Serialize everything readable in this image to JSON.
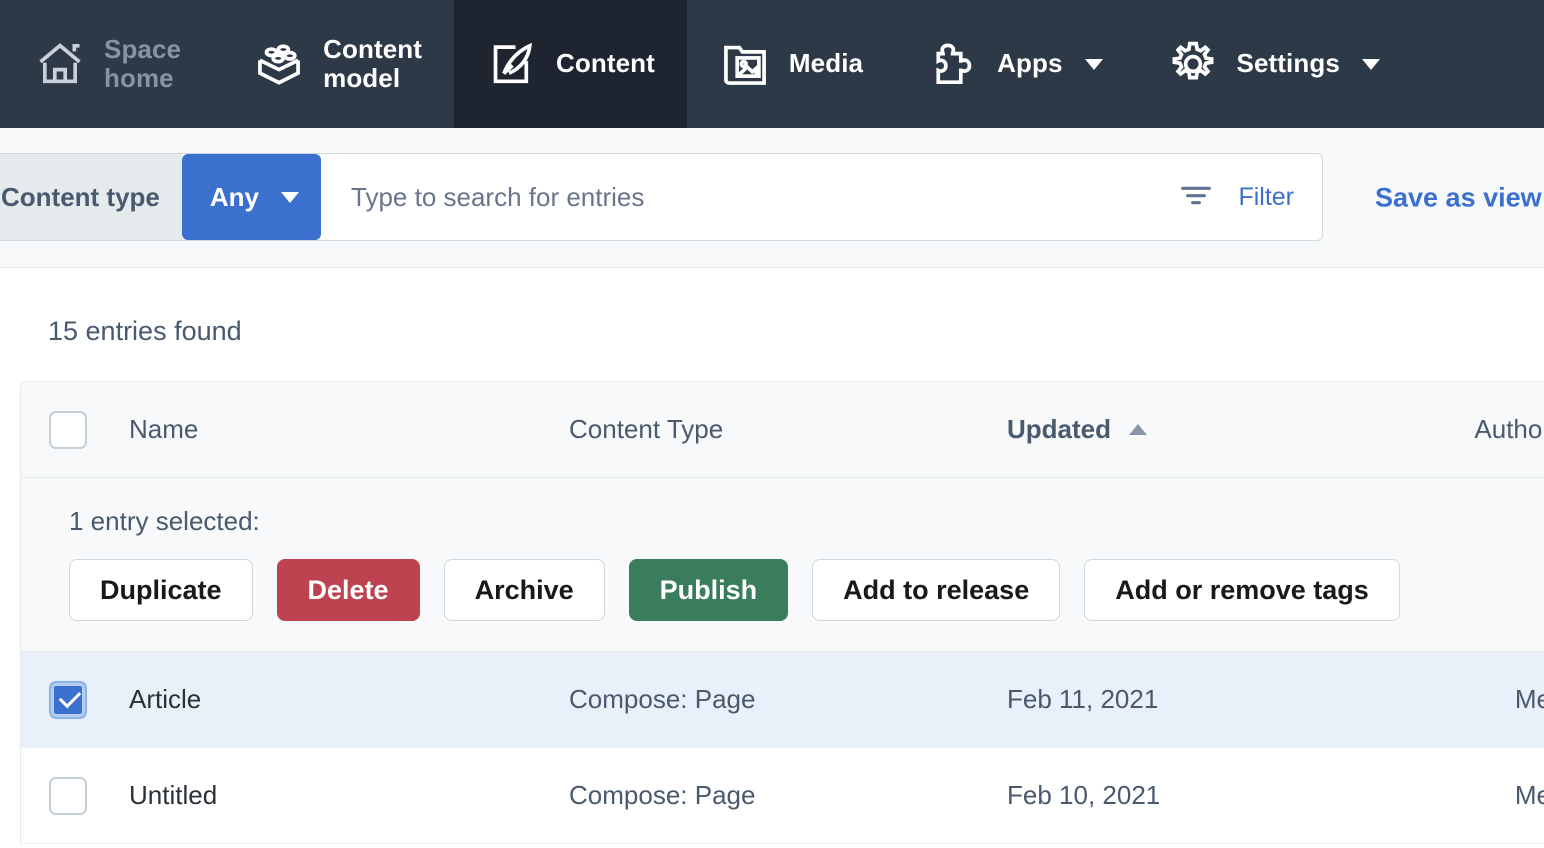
{
  "colors": {
    "nav_bg": "#2e3948",
    "nav_active_bg": "#1e2531",
    "accent_blue": "#3c70cf",
    "danger_red": "#bd4350",
    "positive_green": "#3a7d5c",
    "selected_row": "#e9f0fa",
    "toolbar_bg": "#f7f9fa",
    "border": "#e5ebed"
  },
  "topnav": {
    "items": [
      {
        "label": "Space\nhome",
        "icon": "home-icon",
        "active": false,
        "muted": true,
        "caret": false
      },
      {
        "label": "Content\nmodel",
        "icon": "content-model-icon",
        "active": false,
        "muted": false,
        "caret": false
      },
      {
        "label": "Content",
        "icon": "content-quill-icon",
        "active": true,
        "muted": false,
        "caret": false
      },
      {
        "label": "Media",
        "icon": "media-image-icon",
        "active": false,
        "muted": false,
        "caret": false
      },
      {
        "label": "Apps",
        "icon": "apps-puzzle-icon",
        "active": false,
        "muted": false,
        "caret": true
      },
      {
        "label": "Settings",
        "icon": "settings-gear-icon",
        "active": false,
        "muted": false,
        "caret": true
      }
    ]
  },
  "toolbar": {
    "content_type_label": "Content type",
    "content_type_value": "Any",
    "search_placeholder": "Type to search for entries",
    "search_value": "",
    "filter_label": "Filter",
    "save_as_view_label": "Save as view"
  },
  "main": {
    "entries_found": "15 entries found",
    "columns": [
      {
        "key": "name",
        "label": "Name",
        "sorted": false
      },
      {
        "key": "type",
        "label": "Content Type",
        "sorted": false
      },
      {
        "key": "updated",
        "label": "Updated",
        "sorted": true,
        "sort_dir": "asc"
      },
      {
        "key": "author",
        "label": "Author",
        "sorted": false
      }
    ],
    "select_all_checked": false,
    "bulk": {
      "label": "1 entry selected:",
      "buttons": [
        {
          "label": "Duplicate",
          "style": "secondary"
        },
        {
          "label": "Delete",
          "style": "danger"
        },
        {
          "label": "Archive",
          "style": "secondary"
        },
        {
          "label": "Publish",
          "style": "positive"
        },
        {
          "label": "Add to release",
          "style": "secondary"
        },
        {
          "label": "Add or remove tags",
          "style": "secondary"
        }
      ]
    },
    "rows": [
      {
        "selected": true,
        "name": "Article",
        "type": "Compose: Page",
        "updated": "Feb 11, 2021",
        "author": "Me"
      },
      {
        "selected": false,
        "name": "Untitled",
        "type": "Compose: Page",
        "updated": "Feb 10, 2021",
        "author": "Me"
      }
    ]
  }
}
